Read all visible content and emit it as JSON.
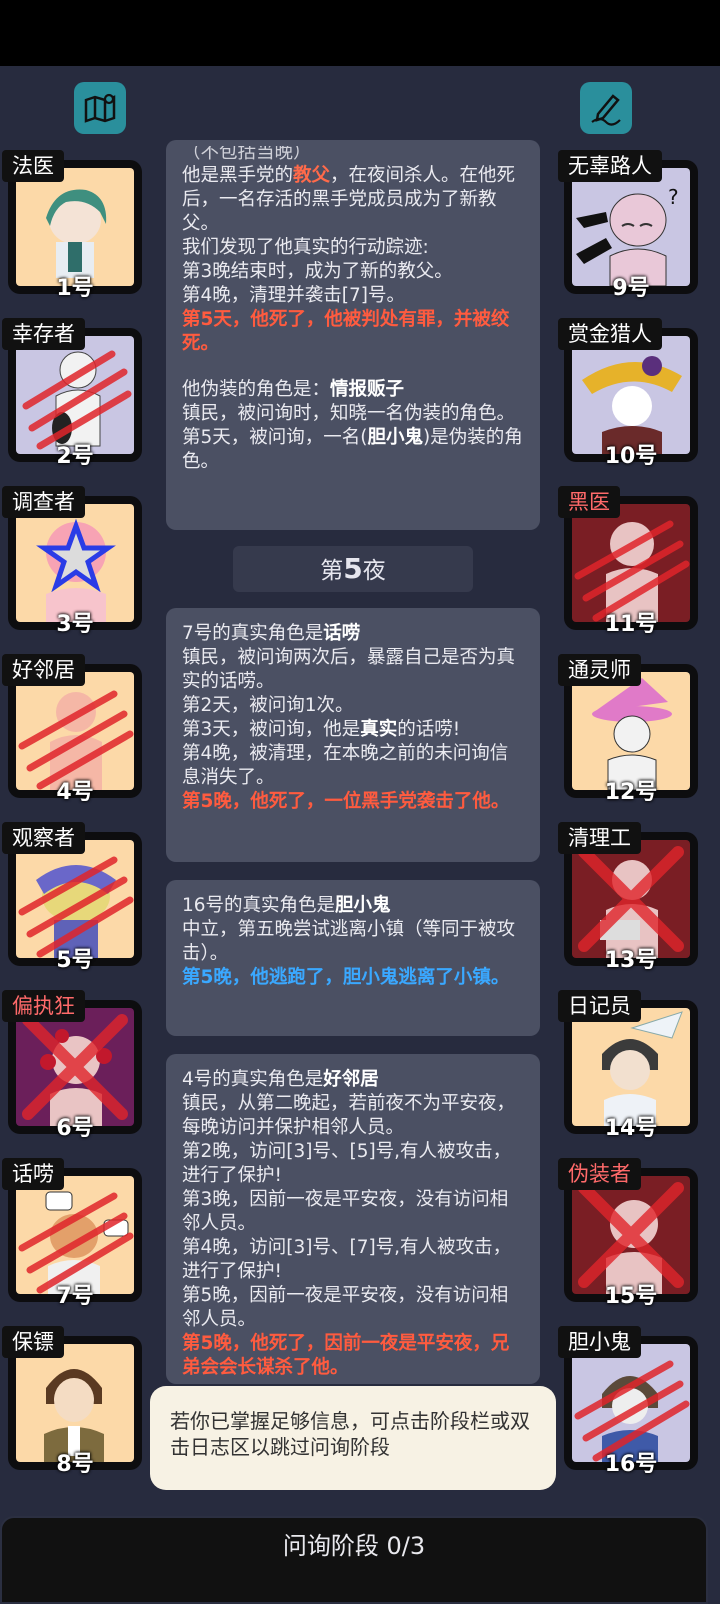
{
  "phase": {
    "label": "问询阶段 0/3"
  },
  "night_label": {
    "prefix": "第",
    "number": "5",
    "suffix": "夜"
  },
  "tooltip": {
    "text": "若你已掌握足够信息，可点击阶段栏或双击日志区以跳过问询阶段"
  },
  "left_players": [
    {
      "role": "法医",
      "number": "1号"
    },
    {
      "role": "幸存者",
      "number": "2号"
    },
    {
      "role": "调查者",
      "number": "3号"
    },
    {
      "role": "好邻居",
      "number": "4号"
    },
    {
      "role": "观察者",
      "number": "5号"
    },
    {
      "role": "偏执狂",
      "number": "6号"
    },
    {
      "role": "话唠",
      "number": "7号"
    },
    {
      "role": "保镖",
      "number": "8号"
    }
  ],
  "right_players": [
    {
      "role": "无辜路人",
      "number": "9号"
    },
    {
      "role": "赏金猎人",
      "number": "10号"
    },
    {
      "role": "黑医",
      "number": "11号"
    },
    {
      "role": "通灵师",
      "number": "12号"
    },
    {
      "role": "清理工",
      "number": "13号"
    },
    {
      "role": "日记员",
      "number": "14号"
    },
    {
      "role": "伪装者",
      "number": "15号"
    },
    {
      "role": "胆小鬼",
      "number": "16号"
    }
  ],
  "log1": {
    "top_cut": "（不包括当晚）",
    "l1a": "他是黑手党的",
    "l1k": "教父",
    "l1b": "，在夜间杀人。在他死后，一名存活的黑手党成员成为了新教父。",
    "l2": "我们发现了他真实的行动踪迹:",
    "l3": "第3晚结束时，成为了新的教父。",
    "l4": "第4晚，清理并袭击[7]号。",
    "death": "第5天，他死了，他被判处有罪，并被绞死。",
    "disguise_a": "他伪装的角色是：",
    "disguise_k": "情报贩子",
    "l5": "镇民，被问询时，知晓一名伪装的角色。",
    "l6a": "第5天，被问询，一名(",
    "l6k": "胆小鬼",
    "l6b": ")是伪装的角色。"
  },
  "log2": {
    "title_a": "7号的真实角色是",
    "title_k": "话唠",
    "l1": "镇民，被问询两次后，暴露自己是否为真实的话唠。",
    "l2": "第2天，被问询1次。",
    "l3a": "第3天，被问询，他是",
    "l3k": "真实",
    "l3b": "的话唠!",
    "l4": "第4晚，被清理，在本晚之前的未问询信息消失了。",
    "death": "第5晚，他死了，一位黑手党袭击了他。"
  },
  "log3": {
    "title_a": "16号的真实角色是",
    "title_k": "胆小鬼",
    "l1": "中立，第五晚尝试逃离小镇（等同于被攻击）。",
    "escape": "第5晚，他逃跑了，胆小鬼逃离了小镇。"
  },
  "log4": {
    "title_a": "4号的真实角色是",
    "title_k": "好邻居",
    "l1": "镇民，从第二晚起，若前夜不为平安夜，每晚访问并保护相邻人员。",
    "l2": "第2晚，访问[3]号、[5]号,有人被攻击，进行了保护!",
    "l3": "第3晚，因前一夜是平安夜，没有访问相邻人员。",
    "l4": "第4晚，访问[3]号、[7]号,有人被攻击，进行了保护!",
    "l5": "第5晚，因前一夜是平安夜，没有访问相邻人员。",
    "death": "第5晚，他死了，因前一夜是平安夜，兄弟会会长谋杀了他。"
  },
  "colors": {
    "accent_teal": "#2a8f9c",
    "death_red": "#ff5b3f",
    "escape_blue": "#3aa8ff",
    "background": "#272b3e"
  }
}
